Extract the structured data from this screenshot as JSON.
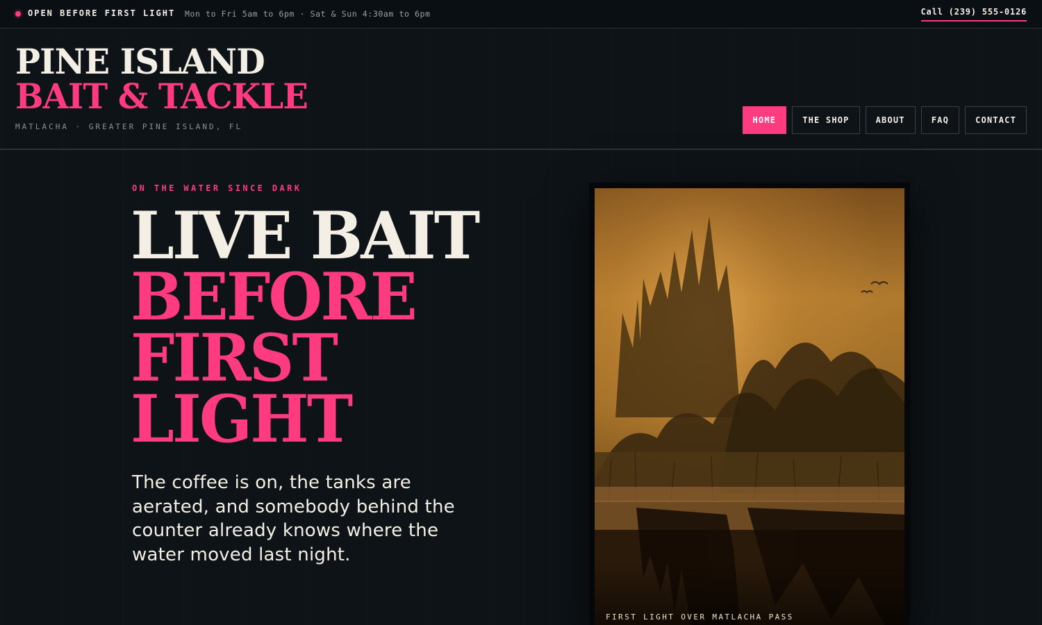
{
  "topbar": {
    "status": "OPEN BEFORE FIRST LIGHT",
    "hours": "Mon to Fri 5am to 6pm · Sat & Sun 4:30am to 6pm",
    "call": "Call (239) 555-0126"
  },
  "brand": {
    "line1": "PINE ISLAND",
    "line2": "BAIT & TACKLE",
    "location": "MATLACHA · GREATER PINE ISLAND, FL"
  },
  "nav": {
    "items": [
      {
        "label": "HOME",
        "active": true
      },
      {
        "label": "THE SHOP"
      },
      {
        "label": "ABOUT"
      },
      {
        "label": "FAQ"
      },
      {
        "label": "CONTACT"
      }
    ]
  },
  "hero": {
    "eyebrow": "ON THE WATER SINCE DARK",
    "headline": [
      "LIVE BAIT",
      "BEFORE",
      "FIRST",
      "LIGHT"
    ],
    "copy": "The coffee is on, the tanks are aerated, and somebody behind the counter already knows where the water moved last night.",
    "photo_caption": "FIRST LIGHT OVER MATLACHA PASS"
  },
  "colors": {
    "accent": "#ff3b7f",
    "background": "#0d1317",
    "text": "#f3efe4"
  }
}
